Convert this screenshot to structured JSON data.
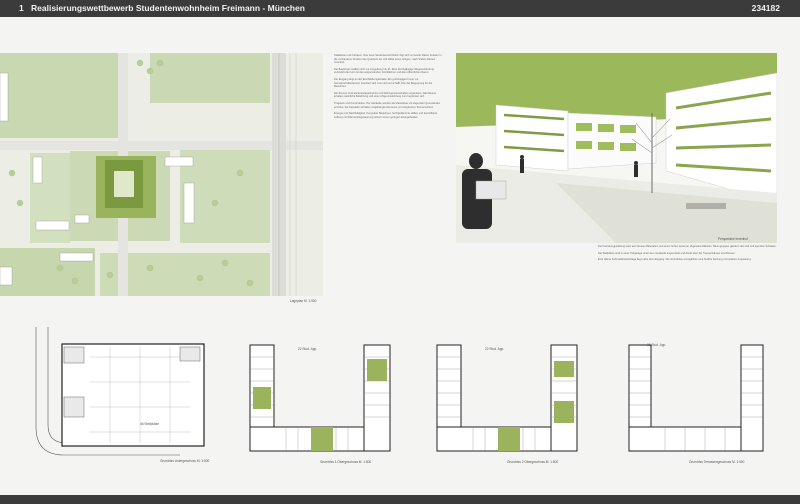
{
  "header": {
    "number": "1",
    "title": "Realisierungswettbewerb Studentenwohnheim Freimann - München",
    "code": "234182"
  },
  "site_plan": {
    "caption": "Lageplan M. 1:500"
  },
  "rendering": {
    "caption": "Perspektive Innenhof"
  },
  "description": {
    "col1": [
      "Städtebau und Freiraum. Das neue Studentenwohnheim fügt sich mit seiner klaren Kubatur in die vorhandene Struktur des Quartiers ein und bildet einen ruhigen, nach Süden offenen Innenhof.",
      "Die Baukörper staffeln sich zur Umgebung hin ab. Eine durchgängige Wegeverbindung verknüpft den Hof mit den angrenzenden Grünflächen und dem öffentlichen Raum.",
      "Der Eingang liegt an der Erschließungsstraße. Ein großzügiges Foyer mit Gemeinschaftsräumen orientiert sich zum Hof und schafft Orte der Begegnung für die Bewohner.",
      "Die Zimmer sind als Einzelapartments und Wohngemeinschaften organisiert. Alle Räume erhalten natürliche Belichtung und eine ruhige Ausrichtung zum begrünten Hof.",
      "Tragwerk und Konstruktion. Die Gebäude werden als Massivbau mit tragenden Querwänden errichtet, die Fassaden erhalten vorgehängte Elemente mit integriertem Sonnenschutz.",
      "Energie und Nachhaltigkeit. Kompakte Baukörper, hochgedämmte Hüllen und kontrollierte Lüftung mit Wärmerückgewinnung sichern einen geringen Energiebedarf."
    ],
    "col2": [
      "Die Freiraumgestaltung setzt auf robuste Materialien und einen hohen Anteil an Vegetationsflächen. Baumgruppen gliedern den Hof und spenden Schatten.",
      "Die Stellplätze sind in einer Tiefgarage unter dem Gebäude angeordnet und direkt über die Treppenhäuser erschlossen.",
      "Eine offene Fahrradabstellanlage liegt nahe dem Eingang. Die Grundrisse ermöglichen eine flexible Nutzung und spätere Anpassung."
    ]
  },
  "floor_plans": [
    {
      "caption": "Grundriss Untergeschoss M. 1:500",
      "label": "46 Stellplätze"
    },
    {
      "caption": "Grundriss 1.Obergeschoss M. 1:500",
      "label": "22 Stud. App."
    },
    {
      "caption": "Grundriss 2.Obergeschoss M. 1:500",
      "label": "22 Stud. App."
    },
    {
      "caption": "Grundriss Terrassengeschoss M. 1:500",
      "label": "21 Stud. App."
    }
  ],
  "colors": {
    "header": "#3b3b3b",
    "green": "#8aa64c",
    "grass": "#c9d9b1",
    "bg": "#f4f4f2"
  }
}
